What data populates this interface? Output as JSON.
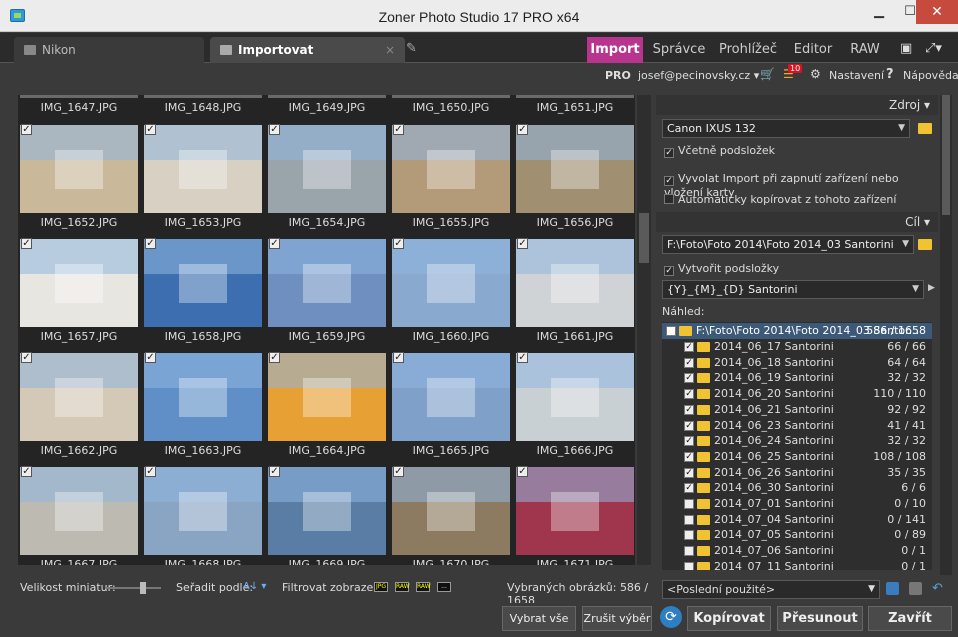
{
  "window": {
    "title": "Zoner Photo Studio 17 PRO x64"
  },
  "tabs": {
    "nikon": "Nikon",
    "importovat": "Importovat",
    "close": "×"
  },
  "modes": [
    "Import",
    "Správce",
    "Prohlížeč",
    "Editor",
    "RAW"
  ],
  "account": {
    "pro": "PRO",
    "email": "josef@pecinovsky.cz ▾",
    "notifications": "10",
    "settings": "Nastavení",
    "help": "Nápověda"
  },
  "thumbnails": {
    "top_row": [
      "IMG_1647.JPG",
      "IMG_1648.JPG",
      "IMG_1649.JPG",
      "IMG_1650.JPG",
      "IMG_1651.JPG"
    ],
    "rows": [
      [
        "IMG_1652.JPG",
        "IMG_1653.JPG",
        "IMG_1654.JPG",
        "IMG_1655.JPG",
        "IMG_1656.JPG"
      ],
      [
        "IMG_1657.JPG",
        "IMG_1658.JPG",
        "IMG_1659.JPG",
        "IMG_1660.JPG",
        "IMG_1661.JPG"
      ],
      [
        "IMG_1662.JPG",
        "IMG_1663.JPG",
        "IMG_1664.JPG",
        "IMG_1665.JPG",
        "IMG_1666.JPG"
      ],
      [
        "IMG_1667.JPG",
        "IMG_1668.JPG",
        "IMG_1669.JPG",
        "IMG_1670.JPG",
        "IMG_1671.JPG"
      ]
    ],
    "colors": [
      [
        "#c9b89a",
        "#d8d0c2",
        "#9aa4ab",
        "#b39a79",
        "#a08f70"
      ],
      [
        "#e8e6e0",
        "#3d6fb0",
        "#6e8fc0",
        "#8aa9cf",
        "#cfd3d6"
      ],
      [
        "#d4c8b6",
        "#5f8fc6",
        "#e6a034",
        "#7fa0c9",
        "#c9d0d4"
      ],
      [
        "#bdbab2",
        "#8aa5c4",
        "#5a7da6",
        "#8c7b60",
        "#a0364d"
      ]
    ]
  },
  "panel": {
    "zdroj": "Zdroj",
    "source_device": "Canon IXUS 132",
    "incl_subfolders": "Včetně podsložek",
    "auto_import": "Vyvolat Import při zapnutí zařízení nebo vložení karty",
    "auto_copy": "Automaticky kopírovat z tohoto zařízení",
    "cil": "Cíl",
    "target_path": "F:\\Foto\\Foto 2014\\Foto 2014_03 Santorini",
    "create_subfolders": "Vytvořit podsložky",
    "subfolder_pattern": "{Y}_{M}_{D}  Santorini",
    "preview_label": "Náhled:",
    "tree_root": {
      "name": "F:\\Foto\\Foto 2014\\Foto 2014_03 Santor...",
      "count": "586 / 1658"
    },
    "tree": [
      {
        "name": "2014_06_17  Santorini",
        "count": "66 / 66",
        "checked": true
      },
      {
        "name": "2014_06_18  Santorini",
        "count": "64 / 64",
        "checked": true
      },
      {
        "name": "2014_06_19  Santorini",
        "count": "32 / 32",
        "checked": true
      },
      {
        "name": "2014_06_20  Santorini",
        "count": "110 / 110",
        "checked": true
      },
      {
        "name": "2014_06_21  Santorini",
        "count": "92 / 92",
        "checked": true
      },
      {
        "name": "2014_06_23  Santorini",
        "count": "41 / 41",
        "checked": true
      },
      {
        "name": "2014_06_24  Santorini",
        "count": "32 / 32",
        "checked": true
      },
      {
        "name": "2014_06_25  Santorini",
        "count": "108 / 108",
        "checked": true
      },
      {
        "name": "2014_06_26  Santorini",
        "count": "35 / 35",
        "checked": true
      },
      {
        "name": "2014_06_30  Santorini",
        "count": "6 / 6",
        "checked": true
      },
      {
        "name": "2014_07_01  Santorini",
        "count": "0 / 10",
        "checked": false
      },
      {
        "name": "2014_07_04  Santorini",
        "count": "0 / 141",
        "checked": false
      },
      {
        "name": "2014_07_05  Santorini",
        "count": "0 / 89",
        "checked": false
      },
      {
        "name": "2014_07_06  Santorini",
        "count": "0 / 1",
        "checked": false
      },
      {
        "name": "2014_07_11  Santorini",
        "count": "0 / 1",
        "checked": false
      }
    ],
    "last_used": "<Poslední použité>"
  },
  "statusbar": {
    "thumb_size": "Velikost miniatur:",
    "sort": "Seřadit podle:",
    "filter": "Filtrovat zobrazení:",
    "filter_icons": [
      "JPG",
      "RAW",
      "RAW",
      "..."
    ],
    "selected": "Vybraných obrázků: 586 / 1658"
  },
  "buttons": {
    "select_all": "Vybrat vše",
    "deselect": "Zrušit výběr",
    "copy": "Kopírovat",
    "move": "Přesunout",
    "close": "Zavřít"
  }
}
